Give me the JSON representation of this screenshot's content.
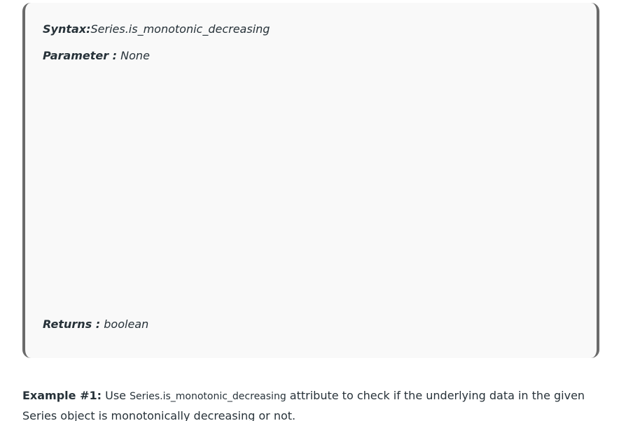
{
  "syntax_box": {
    "syntax": {
      "label": "Syntax:",
      "value": "Series.is_monotonic_decreasing"
    },
    "parameter": {
      "label": "Parameter :",
      "value": " None"
    },
    "returns": {
      "label": "Returns :",
      "value": " boolean"
    }
  },
  "example": {
    "label": "Example #1:",
    "text_before": " Use ",
    "code": "Series.is_monotonic_decreasing",
    "text_after": " attribute to check if the underlying data in the given Series object is monotonically decreasing or not."
  },
  "colors": {
    "box_background": "#f9f9f9",
    "box_border": "#6a6a6a",
    "text": "#273239"
  }
}
